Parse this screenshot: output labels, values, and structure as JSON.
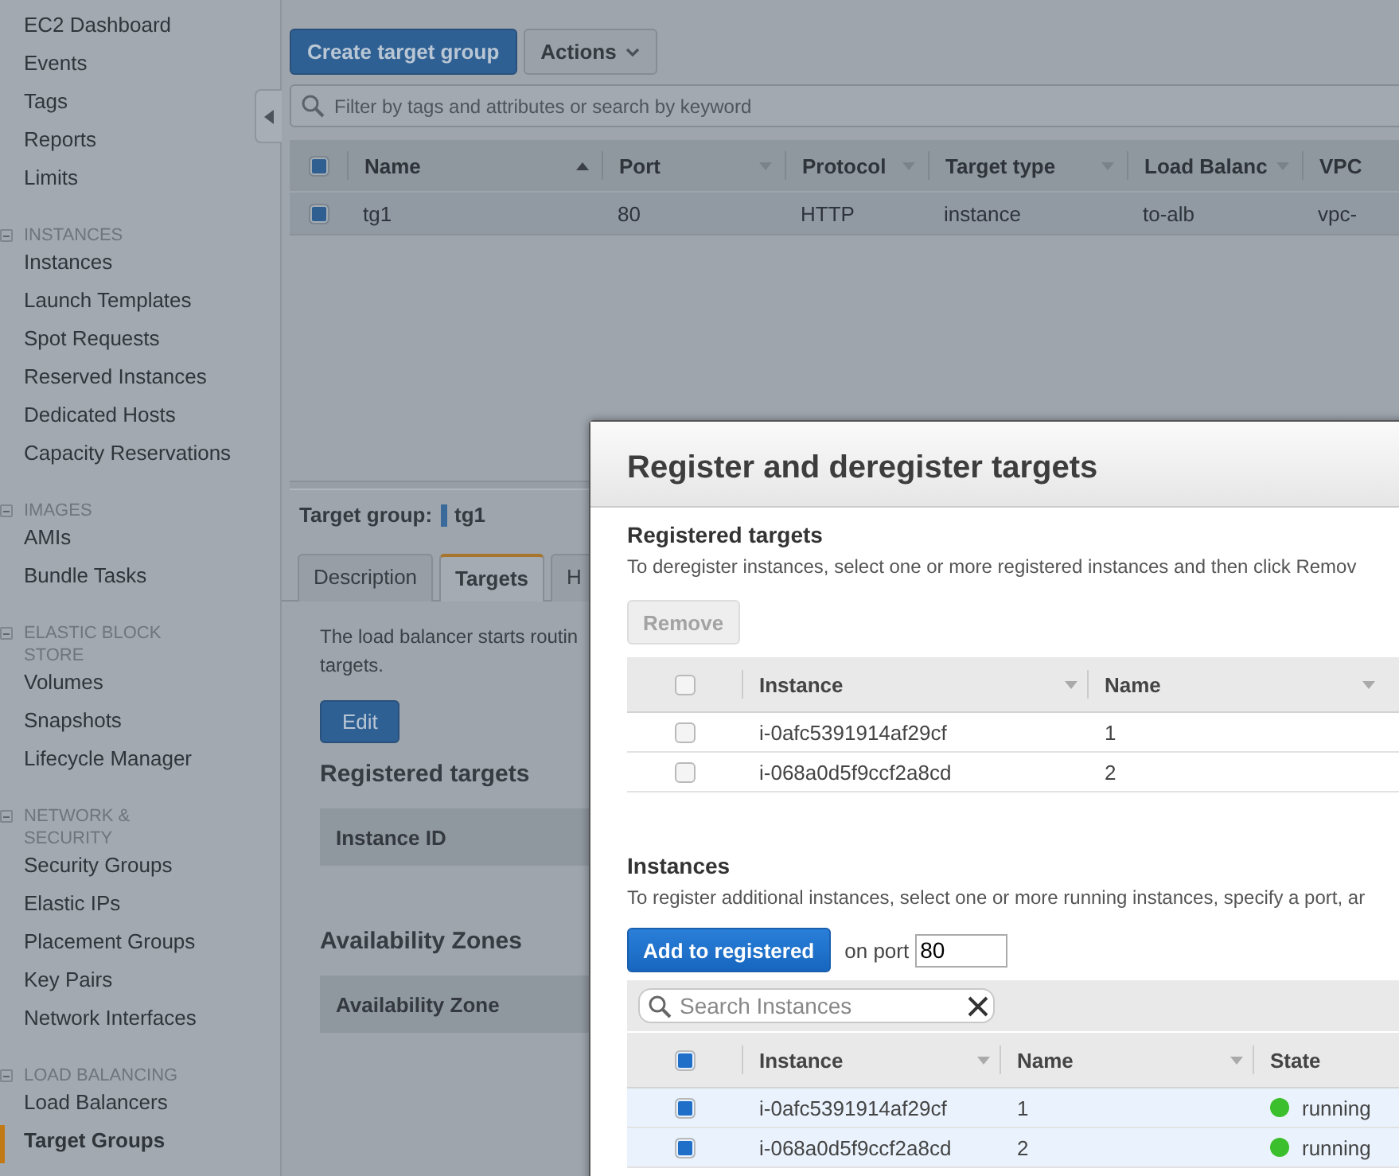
{
  "sidebar": {
    "sections": [
      {
        "items": [
          {
            "label": "EC2 Dashboard",
            "selected": false
          },
          {
            "label": "Events",
            "selected": false
          },
          {
            "label": "Tags",
            "selected": false
          },
          {
            "label": "Reports",
            "selected": false
          },
          {
            "label": "Limits",
            "selected": false
          }
        ]
      },
      {
        "heading": "INSTANCES",
        "items": [
          {
            "label": "Instances",
            "selected": false
          },
          {
            "label": "Launch Templates",
            "selected": false
          },
          {
            "label": "Spot Requests",
            "selected": false
          },
          {
            "label": "Reserved Instances",
            "selected": false
          },
          {
            "label": "Dedicated Hosts",
            "selected": false
          },
          {
            "label": "Capacity Reservations",
            "selected": false
          }
        ]
      },
      {
        "heading": "IMAGES",
        "items": [
          {
            "label": "AMIs",
            "selected": false
          },
          {
            "label": "Bundle Tasks",
            "selected": false
          }
        ]
      },
      {
        "heading": "ELASTIC BLOCK STORE",
        "items": [
          {
            "label": "Volumes",
            "selected": false
          },
          {
            "label": "Snapshots",
            "selected": false
          },
          {
            "label": "Lifecycle Manager",
            "selected": false
          }
        ]
      },
      {
        "heading": "NETWORK & SECURITY",
        "items": [
          {
            "label": "Security Groups",
            "selected": false
          },
          {
            "label": "Elastic IPs",
            "selected": false
          },
          {
            "label": "Placement Groups",
            "selected": false
          },
          {
            "label": "Key Pairs",
            "selected": false
          },
          {
            "label": "Network Interfaces",
            "selected": false
          }
        ]
      },
      {
        "heading": "LOAD BALANCING",
        "items": [
          {
            "label": "Load Balancers",
            "selected": false
          },
          {
            "label": "Target Groups",
            "selected": true
          }
        ]
      }
    ]
  },
  "main": {
    "create_button": "Create target group",
    "actions_button": "Actions",
    "filter": {
      "placeholder": "Filter by tags and attributes or search by keyword"
    },
    "table": {
      "header_checked": true,
      "columns": [
        {
          "label": "Name",
          "sorted": true
        },
        {
          "label": "Port",
          "sorted": false
        },
        {
          "label": "Protocol",
          "sorted": false
        },
        {
          "label": "Target type",
          "sorted": false
        },
        {
          "label": "Load Balanc",
          "sorted": false
        },
        {
          "label": "VPC"
        }
      ],
      "rows": [
        {
          "cells": [
            "tg1",
            "80",
            "HTTP",
            "instance",
            "to-alb",
            "vpc-"
          ],
          "checked": true,
          "selected": true
        }
      ]
    }
  },
  "details": {
    "label": "Target group:",
    "name": "tg1",
    "tabs": [
      {
        "label": "Description",
        "selected": false
      },
      {
        "label": "Targets",
        "selected": true
      },
      {
        "label": "H",
        "selected": false
      }
    ],
    "intro": [
      "The load balancer starts routin",
      "targets."
    ],
    "edit_button": "Edit",
    "sections": [
      {
        "title": "Registered targets",
        "column": "Instance ID"
      },
      {
        "title": "Availability Zones",
        "column": "Availability Zone"
      }
    ]
  },
  "modal": {
    "title": "Register and deregister targets",
    "registered": {
      "heading": "Registered targets",
      "hint": "To deregister instances, select one or more registered instances and then click Remov",
      "remove": {
        "label": "Remove",
        "disabled": true
      },
      "header_checked": false,
      "columns": [
        "Instance",
        "Name"
      ],
      "rows": [
        {
          "instance": "i-0afc5391914af29cf",
          "name": "1",
          "checked": false
        },
        {
          "instance": "i-068a0d5f9ccf2a8cd",
          "name": "2",
          "checked": false
        }
      ]
    },
    "instances": {
      "heading": "Instances",
      "hint": "To register additional instances, select one or more running instances, specify a port, ar",
      "add_button": "Add to registered",
      "port_label": "on port",
      "port": "80",
      "search": {
        "placeholder": "Search Instances"
      },
      "header_checked": true,
      "columns": [
        "Instance",
        "Name",
        "State"
      ],
      "rows": [
        {
          "instance": "i-0afc5391914af29cf",
          "name": "1",
          "state": "running",
          "color": "#3cbf2c",
          "checked": true,
          "selected": true
        },
        {
          "instance": "i-068a0d5f9ccf2a8cd",
          "name": "2",
          "state": "running",
          "color": "#3cbf2c",
          "checked": true,
          "selected": true
        }
      ]
    }
  }
}
